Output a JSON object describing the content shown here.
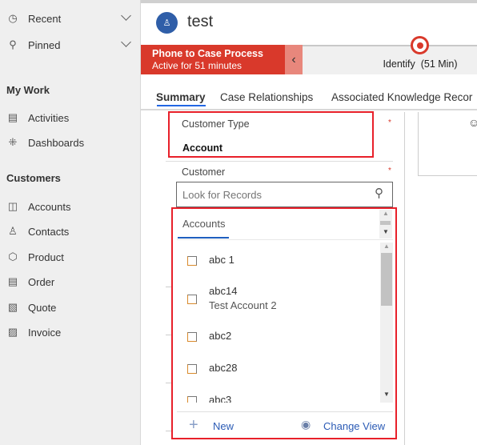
{
  "sidebar": {
    "recent": "Recent",
    "pinned": "Pinned",
    "my_work": "My Work",
    "work_items": [
      {
        "label": "Activities",
        "icon": "clipboard-icon"
      },
      {
        "label": "Dashboards",
        "icon": "dashboard-icon"
      }
    ],
    "customers": "Customers",
    "customer_items": [
      {
        "label": "Accounts",
        "icon": "account-icon"
      },
      {
        "label": "Contacts",
        "icon": "person-icon"
      },
      {
        "label": "Product",
        "icon": "cube-icon"
      },
      {
        "label": "Order",
        "icon": "document-icon"
      },
      {
        "label": "Quote",
        "icon": "quote-icon"
      },
      {
        "label": "Invoice",
        "icon": "invoice-icon"
      }
    ]
  },
  "header": {
    "title": "test"
  },
  "process": {
    "name": "Phone to Case Process",
    "status": "Active for 51 minutes",
    "stage": "Identify",
    "stage_time": "(51 Min)",
    "accent": "#d9392b"
  },
  "tabs": [
    "Summary",
    "Case Relationships",
    "Associated Knowledge Recor"
  ],
  "form": {
    "customer_type_label": "Customer Type",
    "customer_type_value": "Account",
    "customer_label": "Customer",
    "required": "*",
    "lookup_placeholder": "Look for Records"
  },
  "dropdown": {
    "tab": "Accounts",
    "items": [
      {
        "name": "abc 1",
        "sub": ""
      },
      {
        "name": "abc14",
        "sub": "Test Account 2"
      },
      {
        "name": "abc2",
        "sub": ""
      },
      {
        "name": "abc28",
        "sub": ""
      },
      {
        "name": "abc3",
        "sub": ""
      }
    ],
    "new_label": "New",
    "change_view_label": "Change View"
  }
}
